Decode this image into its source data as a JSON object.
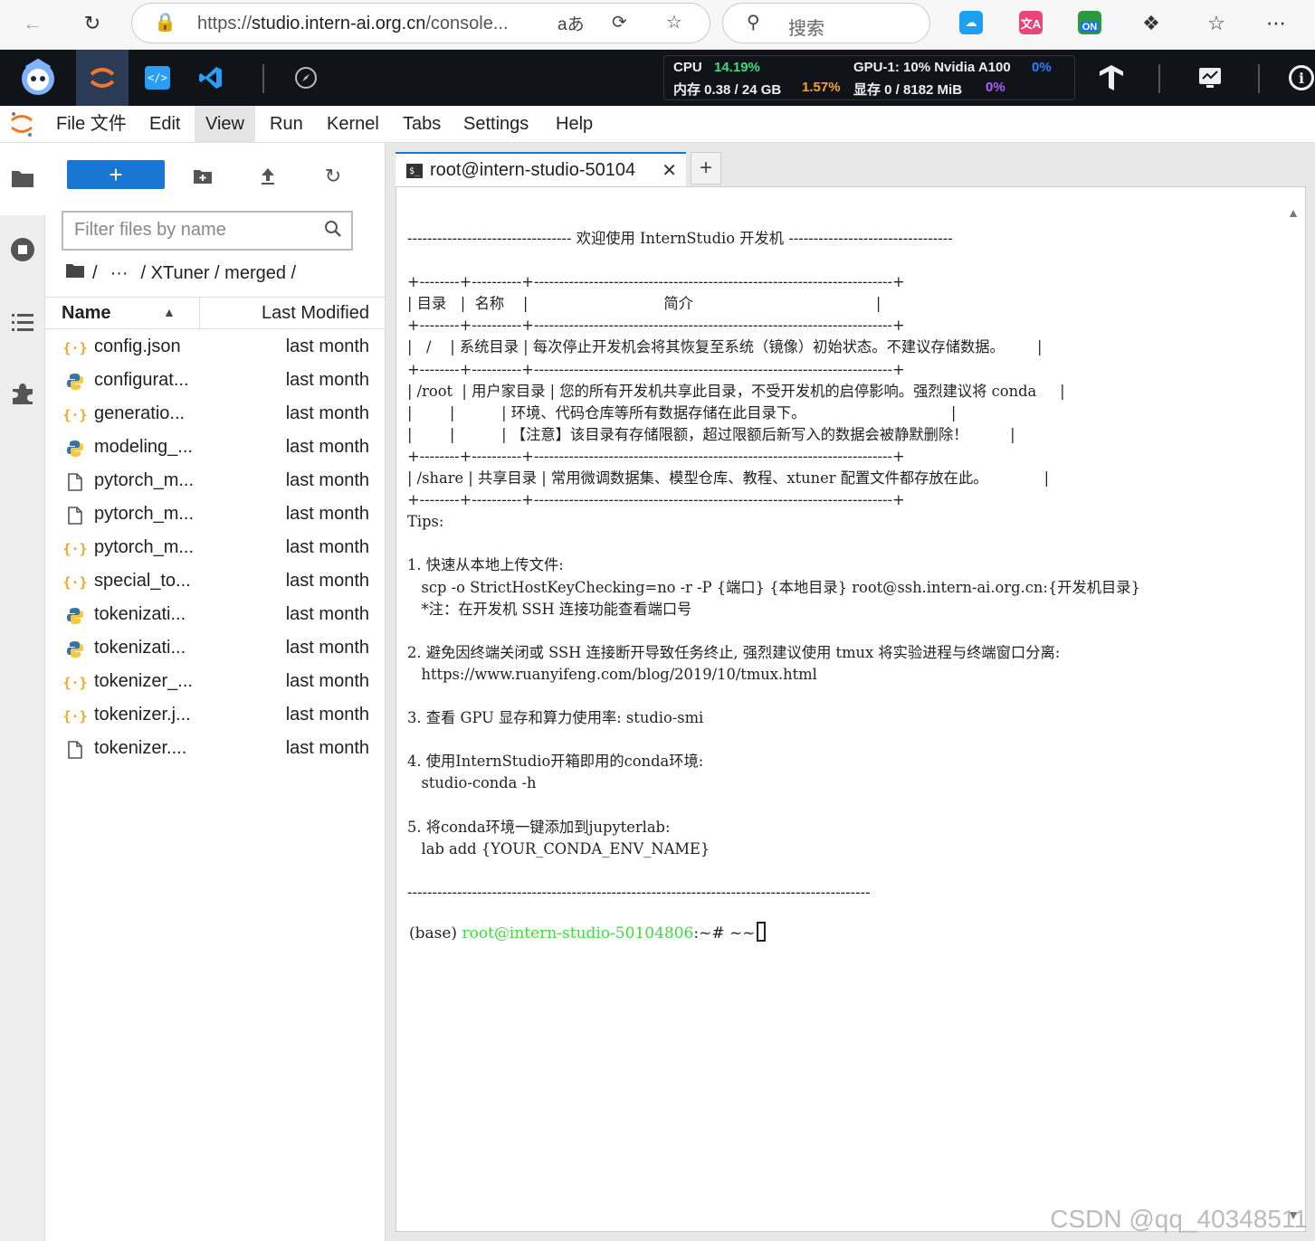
{
  "browser": {
    "url_prefix": "https://",
    "url_domain": "studio.intern-ai.org.cn",
    "url_path": "/console...",
    "search_placeholder": "搜索",
    "ext_on_label": "ON"
  },
  "studio": {
    "metrics": {
      "cpu_label": "CPU",
      "cpu_value": "14.19%",
      "mem_label": "内存 0.38 / 24 GB",
      "mem_value": "1.57%",
      "gpu_label": "GPU-1: 10% Nvidia A100",
      "gpu_value": "0%",
      "vram_label": "显存 0 / 8182 MiB",
      "vram_value": "0%"
    }
  },
  "menu": {
    "items": [
      "File 文件",
      "Edit",
      "View",
      "Run",
      "Kernel",
      "Tabs",
      "Settings",
      "Help"
    ],
    "active": "View"
  },
  "filebrowser": {
    "new_label": "+",
    "filter_placeholder": "Filter files by name",
    "breadcrumb": {
      "root": "/",
      "ellipsis": "···",
      "path": "/ XTuner / merged /"
    },
    "columns": {
      "name": "Name",
      "modified": "Last Modified"
    },
    "files": [
      {
        "name": "config.json",
        "type": "json",
        "modified": "last month"
      },
      {
        "name": "configurat...",
        "type": "python",
        "modified": "last month"
      },
      {
        "name": "generatio...",
        "type": "json",
        "modified": "last month"
      },
      {
        "name": "modeling_...",
        "type": "python",
        "modified": "last month"
      },
      {
        "name": "pytorch_m...",
        "type": "file",
        "modified": "last month"
      },
      {
        "name": "pytorch_m...",
        "type": "file",
        "modified": "last month"
      },
      {
        "name": "pytorch_m...",
        "type": "json",
        "modified": "last month"
      },
      {
        "name": "special_to...",
        "type": "json",
        "modified": "last month"
      },
      {
        "name": "tokenizati...",
        "type": "python",
        "modified": "last month"
      },
      {
        "name": "tokenizati...",
        "type": "python",
        "modified": "last month"
      },
      {
        "name": "tokenizer_...",
        "type": "json",
        "modified": "last month"
      },
      {
        "name": "tokenizer.j...",
        "type": "json",
        "modified": "last month"
      },
      {
        "name": "tokenizer....",
        "type": "file",
        "modified": "last month"
      }
    ]
  },
  "terminal": {
    "tab_label": "root@intern-studio-50104",
    "add_tab": "+",
    "output": "--------------------------------- 欢迎使用 InternStudio 开发机 ---------------------------------\n\n+--------+----------+------------------------------------------------------------------------+\n| 目录   |  名称    |                             简介                                       |\n+--------+----------+------------------------------------------------------------------------+\n|   /    | 系统目录 | 每次停止开发机会将其恢复至系统（镜像）初始状态。不建议存储数据。       |\n+--------+----------+------------------------------------------------------------------------+\n| /root  | 用户家目录 | 您的所有开发机共享此目录，不受开发机的启停影响。强烈建议将 conda     |\n|        |          | 环境、代码仓库等所有数据存储在此目录下。                               |\n|        |          | 【注意】该目录有存储限额，超过限额后新写入的数据会被静默删除！         |\n+--------+----------+------------------------------------------------------------------------+\n| /share | 共享目录 | 常用微调数据集、模型仓库、教程、xtuner 配置文件都存放在此。            |\n+--------+----------+------------------------------------------------------------------------+\nTips:\n\n1. 快速从本地上传文件:\n   scp -o StrictHostKeyChecking=no -r -P {端口} {本地目录} root@ssh.intern-ai.org.cn:{开发机目录}\n   *注：在开发机 SSH 连接功能查看端口号\n\n2. 避免因终端关闭或 SSH 连接断开导致任务终止, 强烈建议使用 tmux 将实验进程与终端窗口分离:\n   https://www.ruanyifeng.com/blog/2019/10/tmux.html\n\n3. 查看 GPU 显存和算力使用率: studio-smi\n\n4. 使用InternStudio开箱即用的conda环境:\n   studio-conda -h\n\n5. 将conda环境一键添加到jupyterlab:\n   lab add {YOUR_CONDA_ENV_NAME}\n\n---------------------------------------------------------------------------------------------",
    "prompt_env": "(base) ",
    "prompt_user": "root@intern-studio-50104806",
    "prompt_rest": ":~# ~~"
  },
  "watermark": "CSDN @qq_40348511",
  "colors": {
    "accent": "#1976d2",
    "prompt_green": "#3ddc3d",
    "studio_bar": "#101418"
  }
}
